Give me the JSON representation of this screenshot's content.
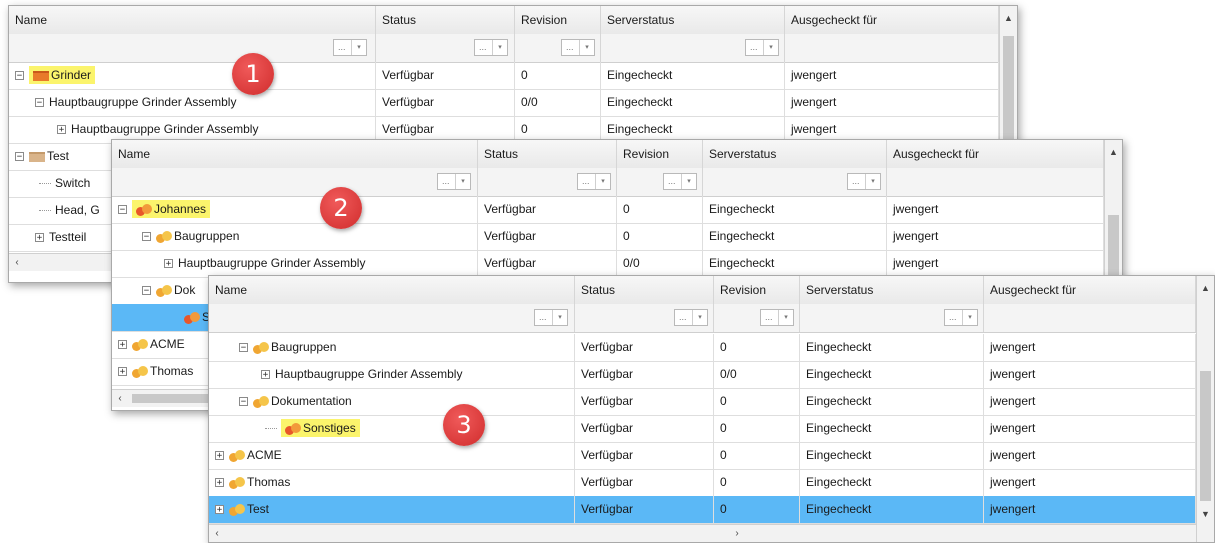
{
  "columns": {
    "name": "Name",
    "status": "Status",
    "revision": "Revision",
    "serverstatus": "Serverstatus",
    "checkedout": "Ausgecheckt für"
  },
  "filter_button": {
    "dots": "...",
    "arrow": "▾"
  },
  "scroll": {
    "up": "▲",
    "down": "▼",
    "left": "‹",
    "right": "›"
  },
  "tree": {
    "expand": "+",
    "collapse": "−"
  },
  "badges": [
    "1",
    "2",
    "3"
  ],
  "window1": {
    "rows": [
      {
        "name": "Grinder",
        "status": "Verfügbar",
        "revision": "0",
        "serverstatus": "Eingecheckt",
        "checkedout": "jwengert"
      },
      {
        "name": "Hauptbaugruppe Grinder Assembly",
        "status": "Verfügbar",
        "revision": "0/0",
        "serverstatus": "Eingecheckt",
        "checkedout": "jwengert"
      },
      {
        "name": "Hauptbaugruppe Grinder Assembly",
        "status": "Verfügbar",
        "revision": "0",
        "serverstatus": "Eingecheckt",
        "checkedout": "jwengert"
      },
      {
        "name": "Test"
      },
      {
        "name": "Switch"
      },
      {
        "name": "Head, G"
      },
      {
        "name": "Testteil"
      }
    ]
  },
  "window2": {
    "rows": [
      {
        "name": "Johannes",
        "status": "Verfügbar",
        "revision": "0",
        "serverstatus": "Eingecheckt",
        "checkedout": "jwengert"
      },
      {
        "name": "Baugruppen",
        "status": "Verfügbar",
        "revision": "0",
        "serverstatus": "Eingecheckt",
        "checkedout": "jwengert"
      },
      {
        "name": "Hauptbaugruppe Grinder Assembly",
        "status": "Verfügbar",
        "revision": "0/0",
        "serverstatus": "Eingecheckt",
        "checkedout": "jwengert"
      },
      {
        "name": "Dok"
      },
      {
        "name": "S"
      },
      {
        "name": "ACME"
      },
      {
        "name": "Thomas"
      }
    ]
  },
  "window3": {
    "rows": [
      {
        "name": "Baugruppen",
        "status": "Verfügbar",
        "revision": "0",
        "serverstatus": "Eingecheckt",
        "checkedout": "jwengert"
      },
      {
        "name": "Hauptbaugruppe Grinder Assembly",
        "status": "Verfügbar",
        "revision": "0/0",
        "serverstatus": "Eingecheckt",
        "checkedout": "jwengert"
      },
      {
        "name": "Dokumentation",
        "status": "Verfügbar",
        "revision": "0",
        "serverstatus": "Eingecheckt",
        "checkedout": "jwengert"
      },
      {
        "name": "Sonstiges",
        "status": "Verfügbar",
        "revision": "0",
        "serverstatus": "Eingecheckt",
        "checkedout": "jwengert"
      },
      {
        "name": "ACME",
        "status": "Verfügbar",
        "revision": "0",
        "serverstatus": "Eingecheckt",
        "checkedout": "jwengert"
      },
      {
        "name": "Thomas",
        "status": "Verfügbar",
        "revision": "0",
        "serverstatus": "Eingecheckt",
        "checkedout": "jwengert"
      },
      {
        "name": "Test",
        "status": "Verfügbar",
        "revision": "0",
        "serverstatus": "Eingecheckt",
        "checkedout": "jwengert"
      }
    ]
  },
  "colors": {
    "selection": "#5bb8f6",
    "highlight": "#fbf46c",
    "badge": "#d93636",
    "folder_orange": "#e87a2a",
    "group_yellow": "#f5c54a"
  }
}
